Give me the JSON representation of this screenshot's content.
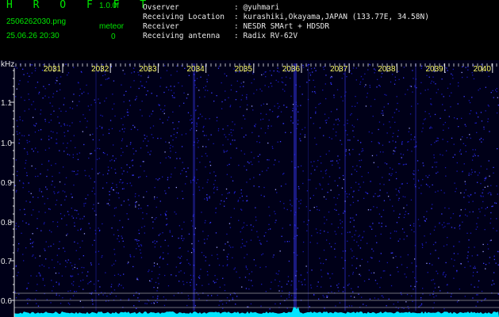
{
  "app": {
    "title": "H R O F F T",
    "version": "1.0.0f",
    "filename": "2506262030.png",
    "datetime": "25.06.26 20:30",
    "meteor_label": "meteor",
    "meteor_count": "0"
  },
  "station": [
    {
      "label": "Ovserver",
      "value": ": @yuhmari"
    },
    {
      "label": "Receiving Location",
      "value": ": kurashiki,Okayama,JAPAN (133.77E, 34.58N)"
    },
    {
      "label": "Receiver",
      "value": ": NESDR SMArt + HDSDR"
    },
    {
      "label": "Receiving antenna",
      "value": ": Radix RV-62V"
    }
  ],
  "spectrogram": {
    "y_unit": "kHz",
    "time_labels": [
      "2031",
      "2032",
      "2033",
      "2034",
      "2035",
      "2036",
      "2037",
      "2038",
      "2039",
      "2040"
    ],
    "freq_labels": [
      "1.1",
      "1.0",
      "0.9",
      "0.8",
      "0.7",
      "0.6"
    ],
    "colors": {
      "background": "#000018",
      "noise": "#1a1aff",
      "ticks": "#e8e8e8",
      "labels": "#ffff66",
      "level": "#00e5ff",
      "markers": "#bbbbbb"
    }
  }
}
